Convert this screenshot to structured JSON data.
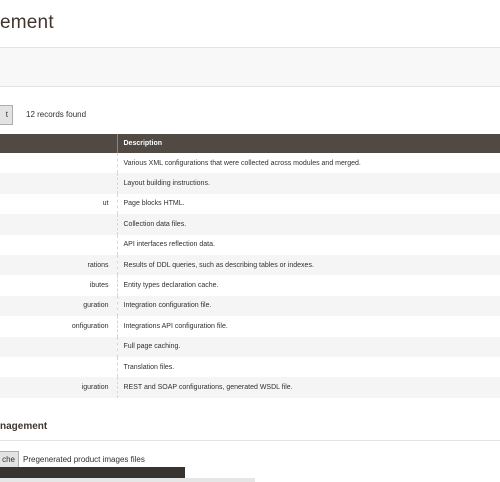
{
  "page": {
    "title": "ement"
  },
  "toolbar": {
    "button_label": "t",
    "records_found": "12 records found"
  },
  "grid": {
    "columns": [
      "",
      "Description"
    ],
    "rows": [
      {
        "type": "",
        "description": "Various XML configurations that were collected across modules and merged."
      },
      {
        "type": "",
        "description": "Layout building instructions."
      },
      {
        "type": "ut",
        "description": "Page blocks HTML."
      },
      {
        "type": "",
        "description": "Collection data files."
      },
      {
        "type": "",
        "description": "API interfaces reflection data."
      },
      {
        "type": "rations",
        "description": "Results of DDL queries, such as describing tables or indexes."
      },
      {
        "type": "ibutes",
        "description": "Entity types declaration cache."
      },
      {
        "type": "guration",
        "description": "Integration configuration file."
      },
      {
        "type": "onfiguration",
        "description": "Integrations API configuration file."
      },
      {
        "type": "",
        "description": "Full page caching."
      },
      {
        "type": "",
        "description": "Translation files."
      },
      {
        "type": "iguration",
        "description": "REST and SOAP configurations, generated WSDL file."
      }
    ]
  },
  "additional": {
    "title": "nagement",
    "button_label": "che",
    "pregenerated_label": "Pregenerated product images files"
  }
}
